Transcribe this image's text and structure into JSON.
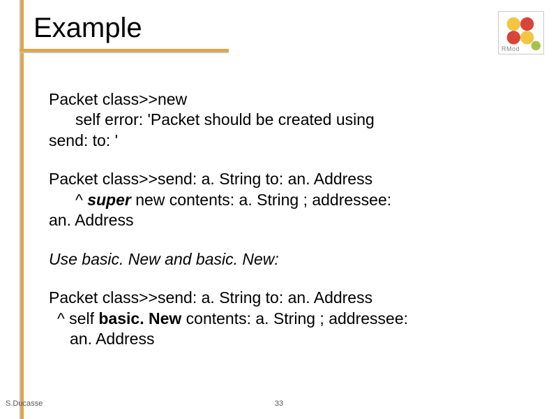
{
  "title": "Example",
  "logo": {
    "label": "RMod"
  },
  "body": {
    "block1": {
      "l1": "Packet class>>new",
      "l2": "self error: 'Packet should be created using",
      "l3": "send: to: '"
    },
    "block2": {
      "l1": "Packet class>>send: a. String to: an. Address",
      "l2a": "^ ",
      "l2b": "super",
      "l2c": " new contents: a. String ; addressee:",
      "l3": "an. Address"
    },
    "block3": {
      "t": "Use basic. New and basic. New:"
    },
    "block4": {
      "l1": "Packet class>>send: a. String to: an. Address",
      "l2a": "^ self ",
      "l2b": "basic. New",
      "l2c": " contents: a. String ; addressee:",
      "l3": "an. Address"
    }
  },
  "footer": {
    "author": "S.Ducasse",
    "page": "33"
  }
}
